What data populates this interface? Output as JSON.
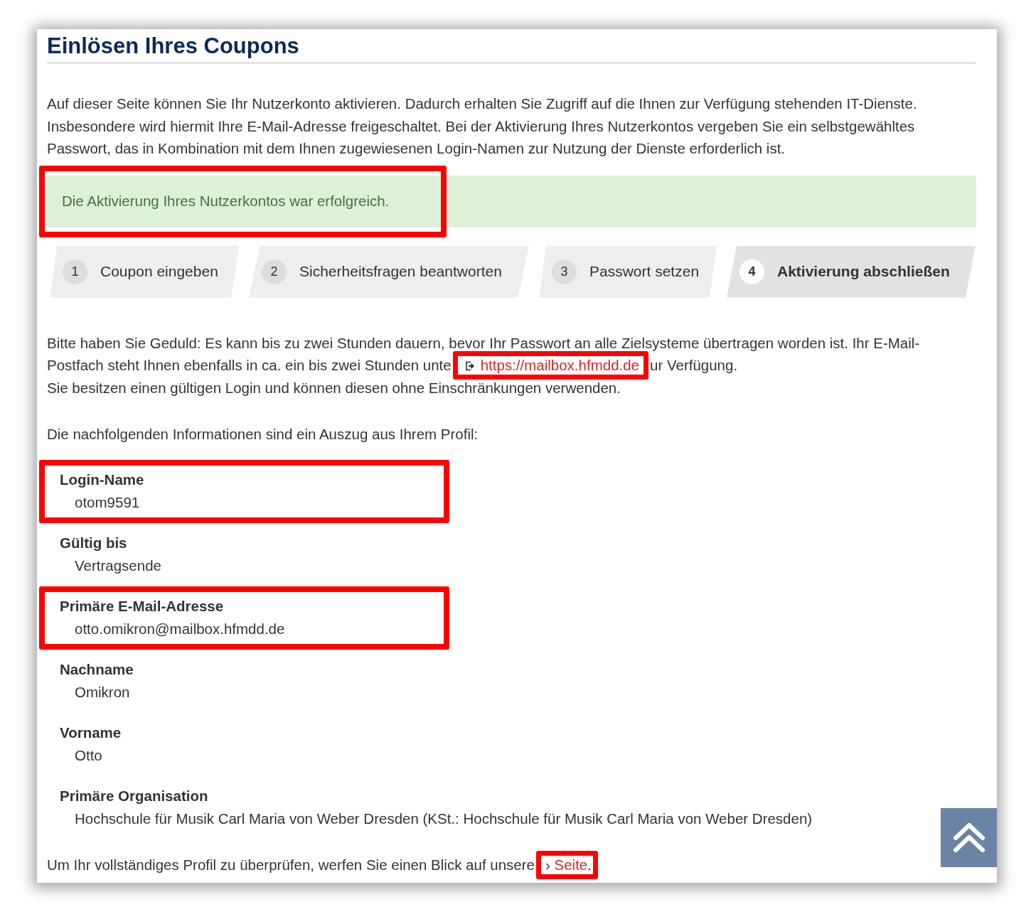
{
  "title": "Einlösen Ihres Coupons",
  "intro": "Auf dieser Seite können Sie Ihr Nutzerkonto aktivieren. Dadurch erhalten Sie Zugriff auf die Ihnen zur Verfügung stehenden IT-Dienste. Insbesondere wird hiermit Ihre E-Mail-Adresse freigeschaltet. Bei der Aktivierung Ihres Nutzerkontos vergeben Sie ein selbstgewähltes Passwort, das in Kombination mit dem Ihnen zugewiesenen Login-Namen zur Nutzung der Dienste erforderlich ist.",
  "alert": {
    "text": "Die Aktivierung Ihres Nutzerkontos war erfolgreich.",
    "highlighted": true
  },
  "steps": [
    {
      "number": "1",
      "label": "Coupon eingeben",
      "selected": false
    },
    {
      "number": "2",
      "label": "Sicherheitsfragen beantworten",
      "selected": false
    },
    {
      "number": "3",
      "label": "Passwort setzen",
      "selected": false
    },
    {
      "number": "4",
      "label": "Aktivierung abschließen",
      "selected": true
    }
  ],
  "notice": {
    "before": "Bitte haben Sie Geduld: Es kann bis zu zwei Stunden dauern, bevor Ihr Passwort an alle Zielsysteme übertragen worden ist. Ihr E-Mail-Postfach steht Ihnen ebenfalls in ca. ein bis zwei Stunden unte",
    "link": "https://mailbox.hfmdd.de",
    "link_highlighted": true,
    "after": "ur Verfügung."
  },
  "login_note": "Sie besitzen einen gültigen Login und können diesen ohne Einschränkungen verwenden.",
  "profile_intro": "Die nachfolgenden Informationen sind ein Auszug aus Ihrem Profil:",
  "profile": [
    {
      "label": "Login-Name",
      "value": "otom9591",
      "highlighted": true
    },
    {
      "label": "Gültig bis",
      "value": "Vertragsende",
      "highlighted": false
    },
    {
      "label": "Primäre E-Mail-Adresse",
      "value": "otto.omikron@mailbox.hfmdd.de",
      "highlighted": true
    },
    {
      "label": "Nachname",
      "value": "Omikron",
      "highlighted": false
    },
    {
      "label": "Vorname",
      "value": "Otto",
      "highlighted": false
    },
    {
      "label": "Primäre Organisation",
      "value": "Hochschule für Musik Carl Maria von Weber Dresden (KSt.: Hochschule für Musik Carl Maria von Weber Dresden)",
      "highlighted": false
    }
  ],
  "footer": {
    "before": "Um Ihr vollständiges Profil zu überprüfen, werfen Sie einen Blick auf unsere",
    "link_icon": "›",
    "link": "Seite",
    "after": ".",
    "link_highlighted": true
  }
}
